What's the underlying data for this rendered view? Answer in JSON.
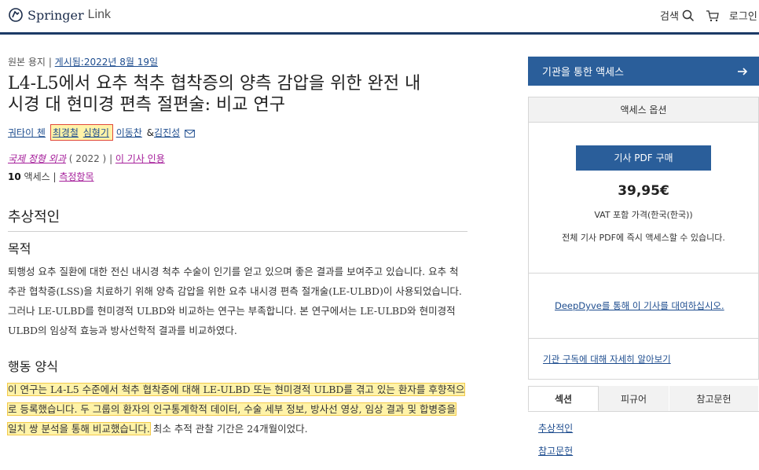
{
  "header": {
    "logo_name": "Springer",
    "logo_sub": "Link",
    "search_label": "검색",
    "login_label": "로그인"
  },
  "article": {
    "type_label": "원본 용지",
    "published": "게시됨:2022년 8월 19일",
    "title_line1": "L4-L5에서 요추 척추 협착증의 양측 감압을 위한 완전 내",
    "title_line2": "시경 대 현미경 편측 절편술: 비교 연구",
    "authors": [
      "궈타이 첸",
      "최경철",
      "심형기",
      "이동찬",
      "김진성"
    ],
    "author_amp": "&",
    "journal": "국제 정형 외과",
    "year": "( 2022 )",
    "cite": "이 기사 인용",
    "access_count": "10",
    "access_label": "액세스",
    "metrics": "측정항목"
  },
  "abstract": {
    "heading": "추상적인",
    "purpose_heading": "목적",
    "purpose_text": "퇴행성 요추 질환에 대한 전신 내시경 척추 수술이 인기를 얻고 있으며 좋은 결과를 보여주고 있습니다. 요추 척추관 협착증(LSS)을 치료하기 위해 양측 감압을 위한 요추 내시경 편측 절개술(LE-ULBD)이 사용되었습니다. 그러나 LE-ULBD를 현미경적 ULBD와 비교하는 연구는 부족합니다. 본 연구에서는 LE-ULBD와 현미경적 ULBD의 임상적 효능과 방사선학적 결과를 비교하였다.",
    "methods_heading": "행동 양식",
    "methods_highlight": "이 연구는 L4-L5 수준에서 척추 협착증에 대해 LE-ULBD 또는 현미경적 ULBD를 겪고 있는 환자를 후향적으로 등록했습니다. 두 그룹의 환자의 인구통계학적 데이터, 수술 세부 정보, 방사선 영상, 임상 결과 및 합병증을 일치 쌍 분석을 통해 비교했습니다.",
    "methods_rest": " 최소 추적 관찰 기간은 24개월이었다."
  },
  "sidebar": {
    "institution_access": "기관을 통한 액세스",
    "access_options": "액세스 옵션",
    "buy_pdf": "기사 PDF 구매",
    "price": "39,95€",
    "vat": "VAT 포함 가격(한국(한국))",
    "instant": "전체 기사 PDF에 즉시 액세스할 수 있습니다.",
    "deepdyve": "DeepDyve를 통해 이 기사를 대여하십시오.",
    "subscription": "기관 구독에 대해 자세히 알아보기",
    "tabs": [
      "섹션",
      "피규어",
      "참고문헌"
    ],
    "section_links": [
      "추상적인",
      "참고문헌"
    ]
  },
  "colors": {
    "brand_navy": "#1c3a66",
    "button_blue": "#2a5e9a",
    "highlight_yellow": "#fff3a8",
    "author_box_red": "#e24a3b"
  }
}
